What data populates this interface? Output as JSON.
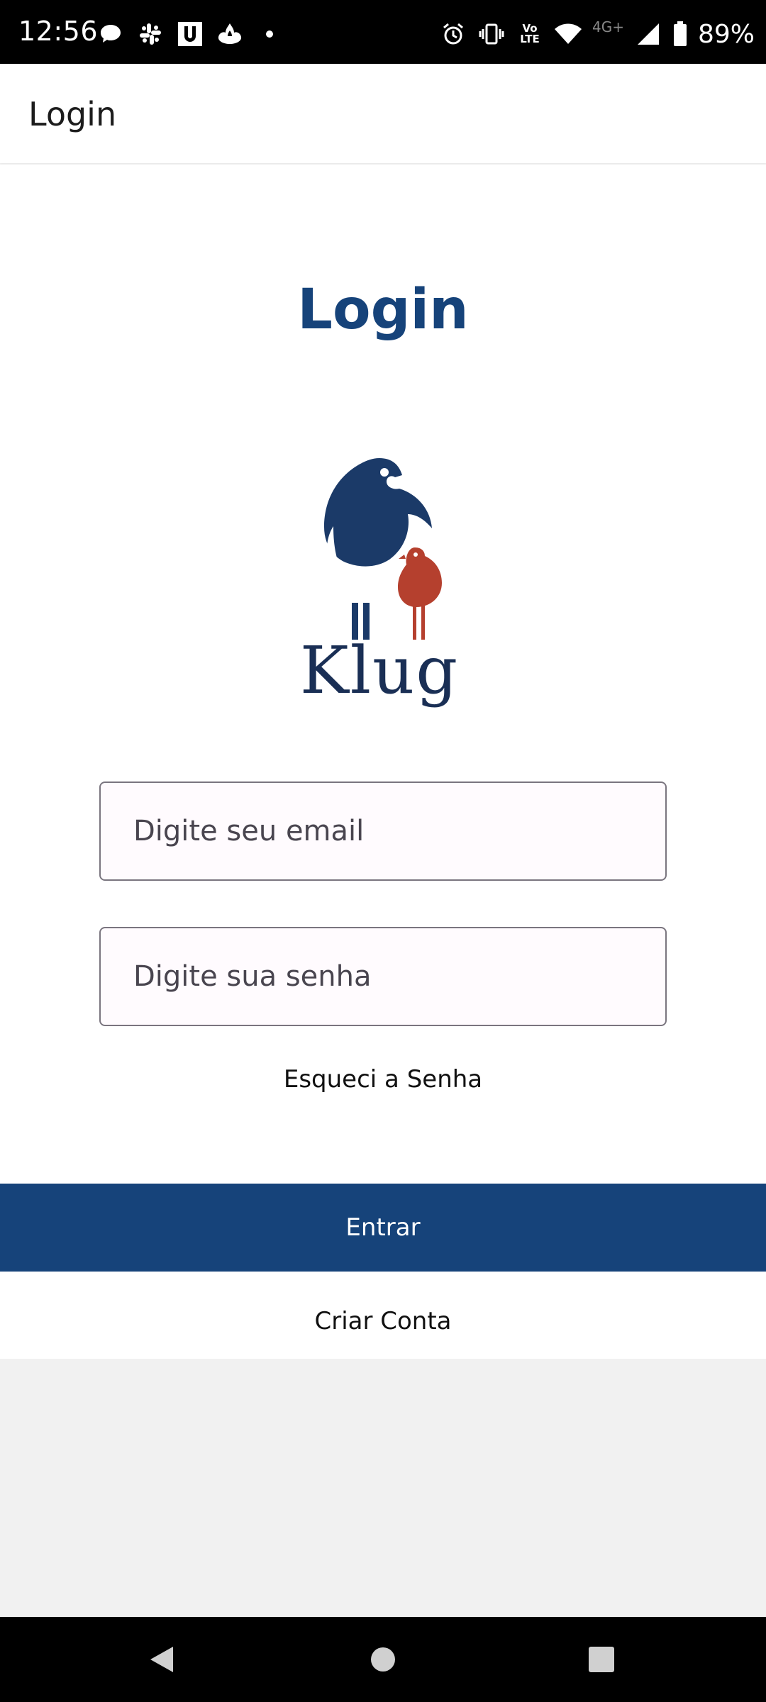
{
  "status_bar": {
    "time": "12:56",
    "battery_percent": "89%",
    "network_label": "4G+",
    "volte_top": "Vo",
    "volte_bottom": "LTE",
    "icons_left": [
      "chat-bubble-icon",
      "slack-icon",
      "u-app-icon",
      "santander-icon",
      "dot-icon"
    ],
    "icons_right": [
      "alarm-icon",
      "vibrate-icon",
      "volte-icon",
      "wifi-icon",
      "signal-icon",
      "battery-icon"
    ]
  },
  "app_bar": {
    "title": "Login"
  },
  "main": {
    "heading": "Login",
    "logo_text": "Klug",
    "email_placeholder": "Digite seu email",
    "password_placeholder": "Digite sua senha",
    "forgot_password": "Esqueci a Senha",
    "enter_button": "Entrar",
    "create_account": "Criar Conta"
  },
  "colors": {
    "primary": "#16437a",
    "bird_large": "#1b3a68",
    "bird_small": "#b5402e",
    "page_bg": "#f1f1f1"
  },
  "nav_bar": {
    "icons": [
      "back-icon",
      "home-icon",
      "recents-icon"
    ]
  }
}
